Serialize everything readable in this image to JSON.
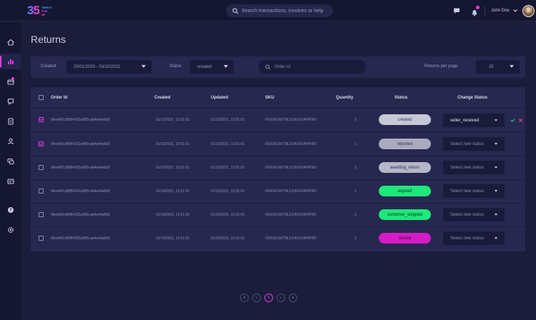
{
  "brand": {
    "logo_number": "35",
    "logo_lines": [
      "THIRTY",
      "FIVE",
      "UP"
    ]
  },
  "topbar": {
    "search_placeholder": "Search transactions, invoices or help",
    "user_name": "John Doe"
  },
  "sidebar": {
    "items": [
      {
        "name": "home-icon",
        "active": false,
        "badge": false
      },
      {
        "name": "chart-icon",
        "active": true,
        "badge": false
      },
      {
        "name": "returns-icon",
        "active": false,
        "badge": true
      },
      {
        "name": "chat-icon",
        "active": false,
        "badge": false
      },
      {
        "name": "document-icon",
        "active": false,
        "badge": false
      },
      {
        "name": "user-icon",
        "active": false,
        "badge": false
      },
      {
        "name": "messages-icon",
        "active": false,
        "badge": false
      },
      {
        "name": "id-card-icon",
        "active": false,
        "badge": false
      },
      {
        "name": "help-icon",
        "active": false,
        "badge": false
      },
      {
        "name": "settings-icon",
        "active": false,
        "badge": false
      }
    ]
  },
  "page": {
    "title": "Returns"
  },
  "filters": {
    "created_label": "Created",
    "created_value": "25/01/2020 - 03/10/2021",
    "status_label": "Status",
    "status_value": "created",
    "order_placeholder": "Order Id",
    "per_page_label": "Returns per page",
    "per_page_value": "25"
  },
  "table": {
    "headers": {
      "order_id": "Order Id",
      "created": "Created",
      "updated": "Updated",
      "sku": "SKU",
      "quantity": "Quantity",
      "status": "Status",
      "change_status": "Change Status"
    },
    "rows": [
      {
        "checked": true,
        "order_id": "0fee842c86f84262a0ff0cab4eb4a8d0",
        "created": "01/10/2021, 12:01:01",
        "updated": "01/10/2021, 12:01:01",
        "sku": "F8XGKIXKTNLD1IKXIXAPIPRD",
        "quantity": "2",
        "status": "created",
        "status_bg": "#c7c8d6",
        "status_fg": "#3a3c55",
        "change": "seller_received",
        "editing": true
      },
      {
        "checked": true,
        "order_id": "0fee842c86f84262a0ff0cab4eb4a8d0",
        "created": "01/10/2021, 12:01:01",
        "updated": "01/10/2021, 12:01:01",
        "sku": "F8XGKIXKTNLD1IKXIXAPIPRD",
        "quantity": "1",
        "status": "rejected",
        "status_bg": "#a9aabd",
        "status_fg": "#2f3150",
        "change": "Select new status",
        "editing": false
      },
      {
        "checked": false,
        "order_id": "0fee842c86f84262a0ff0cab4eb4a8d0",
        "created": "01/10/2021, 12:01:01",
        "updated": "01/10/2021, 12:01:01",
        "sku": "F8XGKIXKTNLD1IKXIXAPIPRD",
        "quantity": "3",
        "status": "awaiting_return",
        "status_bg": "#b5b6c6",
        "status_fg": "#2f3150",
        "change": "Select new status",
        "editing": false
      },
      {
        "checked": false,
        "order_id": "0fee842c86f84262a0ff0cab4eb4a8d0",
        "created": "01/10/2021, 12:01:01",
        "updated": "01/10/2021, 12:01:01",
        "sku": "F8XGKIXKTNLD1IKXIXAPIPRD",
        "quantity": "1",
        "status": "expired",
        "status_bg": "#1ee87a",
        "status_fg": "#0f2a1c",
        "change": "Select new status",
        "editing": false
      },
      {
        "checked": false,
        "order_id": "0fee842c86f84262a0ff0cab4eb4a8d0",
        "created": "01/10/2021, 12:01:01",
        "updated": "01/10/2021, 12:01:01",
        "sku": "F8XGKIXKTNLD1IKXIXAPIPRD",
        "quantity": "2",
        "status": "customer_shipped",
        "status_bg": "#1ee87a",
        "status_fg": "#0f2a1c",
        "change": "Select new status",
        "editing": false
      },
      {
        "checked": false,
        "order_id": "0fee842c86f84262a0ff0cab4eb4a8d0",
        "created": "01/10/2021, 12:01:01",
        "updated": "01/10/2021, 12:01:01",
        "sku": "F8XGKIXKTNLD1IKXIXAPIPRD",
        "quantity": "1",
        "status": "closed",
        "status_bg": "#d61cc6",
        "status_fg": "#2a0b28",
        "change": "Select new status",
        "editing": false
      }
    ]
  },
  "pagination": {
    "first": "«",
    "prev": "‹",
    "current": "5",
    "next": "›",
    "last": "»"
  },
  "colors": {
    "background": "#1c1d3b",
    "panel": "#262850",
    "accent": "#e53be0",
    "success": "#1ee87a"
  }
}
